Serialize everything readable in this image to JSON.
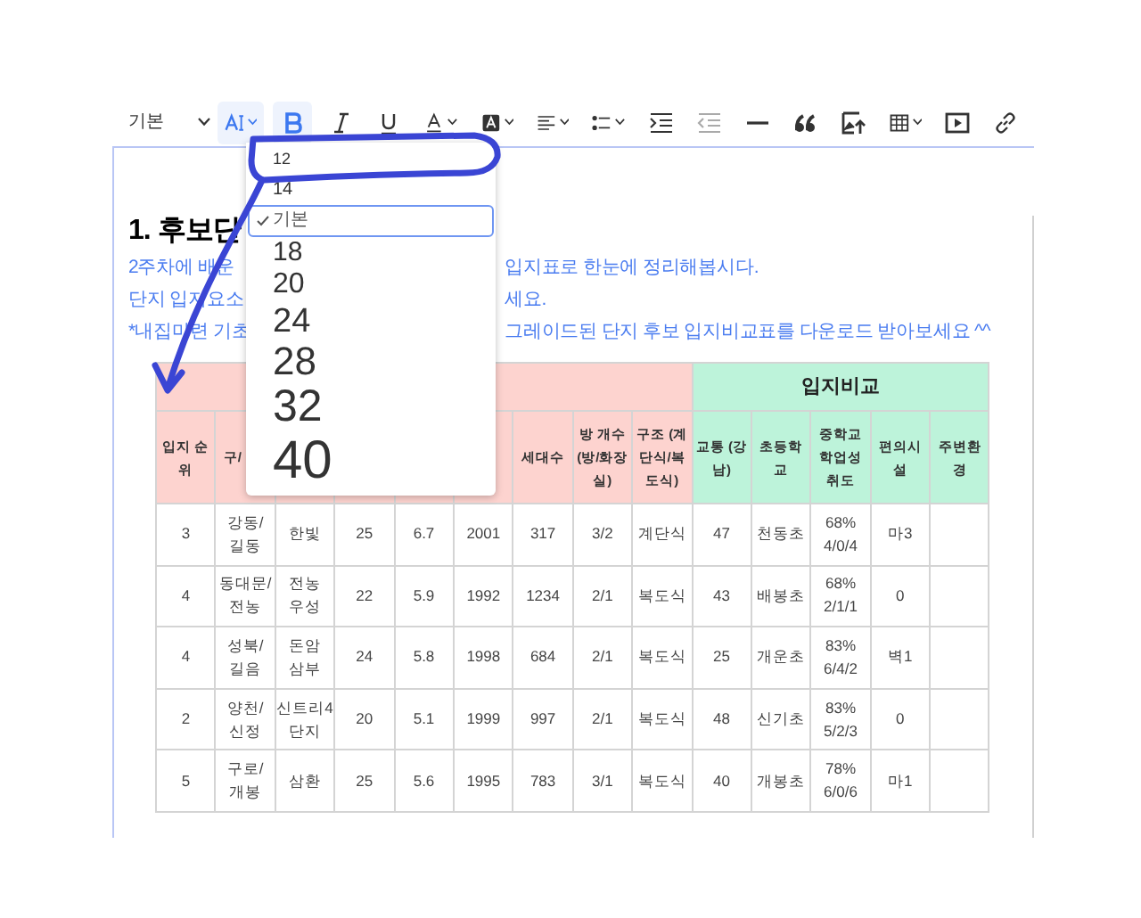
{
  "toolbar": {
    "style_select": "기본",
    "buttons": [
      {
        "kind": "font-size",
        "active": true,
        "caret": true
      },
      {
        "kind": "bold",
        "active": true,
        "caret": false
      },
      {
        "kind": "italic",
        "active": false,
        "caret": false
      },
      {
        "kind": "underline",
        "active": false,
        "caret": false
      },
      {
        "kind": "text-color",
        "active": false,
        "caret": true
      },
      {
        "kind": "highlight",
        "active": false,
        "caret": true
      },
      {
        "kind": "align",
        "active": false,
        "caret": true
      },
      {
        "kind": "list",
        "active": false,
        "caret": true
      },
      {
        "kind": "indent",
        "active": false,
        "caret": false
      },
      {
        "kind": "outdent",
        "active": false,
        "caret": false,
        "disabled": true
      },
      {
        "kind": "rule",
        "active": false,
        "caret": false
      },
      {
        "kind": "quote",
        "active": false,
        "caret": false
      },
      {
        "kind": "image",
        "active": false,
        "caret": false
      },
      {
        "kind": "table",
        "active": false,
        "caret": true
      },
      {
        "kind": "video",
        "active": false,
        "caret": false
      },
      {
        "kind": "link",
        "active": false,
        "caret": false
      }
    ]
  },
  "font_size_menu": [
    {
      "label": "12",
      "selected": false
    },
    {
      "label": "14",
      "selected": false
    },
    {
      "label": "기본",
      "selected": true
    },
    {
      "label": "18",
      "selected": false
    },
    {
      "label": "20",
      "selected": false
    },
    {
      "label": "24",
      "selected": false
    },
    {
      "label": "28",
      "selected": false
    },
    {
      "label": "32",
      "selected": false
    },
    {
      "label": "40",
      "selected": false
    }
  ],
  "heading": "1. 후보단",
  "intro_lines": [
    {
      "left": "2주차에 배운",
      "right": "입지표로 한눈에 정리해봅시다."
    },
    {
      "left": "단지 입지요소",
      "right": "세요."
    },
    {
      "left": "*내집마련 기초",
      "right": "그레이드된 단지 후보 입지비교표를 다운로드 받아보세요 ^^"
    }
  ],
  "table": {
    "groups": [
      {
        "color": "#fdd3cf",
        "columns": [
          "입지 순위",
          "구/",
          null,
          null,
          null,
          null,
          "세대수",
          "방 개수 (방/화장실)",
          "구조 (계단식/복도식)"
        ]
      },
      {
        "color": "#bdf3da",
        "label": "입지비교",
        "columns": [
          "교통 (강남)",
          "초등학교",
          "중학교 학업성취도",
          "편의시설",
          "주변환경"
        ]
      }
    ],
    "rows": [
      [
        "3",
        "강동/\n길동",
        "한빛",
        "25",
        "6.7",
        "2001",
        "317",
        "3/2",
        "계단식",
        "47",
        "천동초",
        "68%\n4/0/4",
        "마3",
        null
      ],
      [
        "4",
        "동대문/\n전농",
        "전농\n우성",
        "22",
        "5.9",
        "1992",
        "1234",
        "2/1",
        "복도식",
        "43",
        "배봉초",
        "68%\n2/1/1",
        "0",
        null
      ],
      [
        "4",
        "성북/\n길음",
        "돈암\n삼부",
        "24",
        "5.8",
        "1998",
        "684",
        "2/1",
        "복도식",
        "25",
        "개운초",
        "83%\n6/4/2",
        "벽1",
        null
      ],
      [
        "2",
        "양천/\n신정",
        "신트리4\n단지",
        "20",
        "5.1",
        "1999",
        "997",
        "2/1",
        "복도식",
        "48",
        "신기초",
        "83%\n5/2/3",
        "0",
        null
      ],
      [
        "5",
        "구로/\n개봉",
        "삼환",
        "25",
        "5.6",
        "1995",
        "783",
        "3/1",
        "복도식",
        "40",
        "개봉초",
        "78%\n6/0/6",
        "마1",
        null
      ]
    ]
  }
}
